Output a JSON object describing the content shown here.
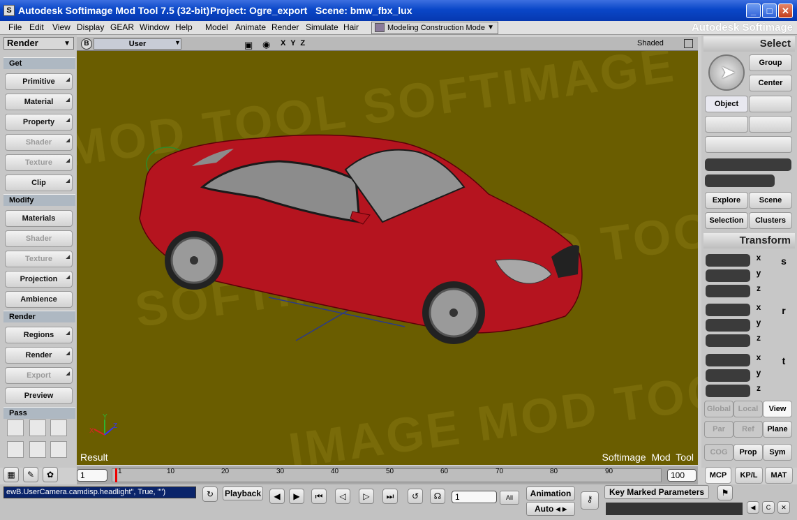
{
  "titlebar": {
    "app": "Autodesk Softimage Mod Tool 7.5 (32-bit)",
    "project": "Project: Ogre_export",
    "scene": "Scene: bmw_fbx_lux",
    "minimize": "_",
    "maximize": "□",
    "close": "✕"
  },
  "menu": {
    "items": [
      "File",
      "Edit",
      "View",
      "Display",
      "GEAR",
      "Window",
      "Help",
      "Model",
      "Animate",
      "Render",
      "Simulate",
      "Hair"
    ],
    "mode": "Modeling Construction Mode",
    "brand": "Autodesk Softimage"
  },
  "left": {
    "tool": "Render",
    "get": "Get",
    "get_items": [
      "Primitive",
      "Material",
      "Property",
      "Shader",
      "Texture",
      "Clip"
    ],
    "modify": "Modify",
    "modify_items": [
      "Materials",
      "Shader",
      "Texture",
      "Projection",
      "Ambience"
    ],
    "render": "Render",
    "render_items": [
      "Regions",
      "Render",
      "Export",
      "Preview"
    ],
    "pass": "Pass"
  },
  "viewport": {
    "cam": "B",
    "camera": "User",
    "axes": "X Y Z",
    "shading": "Shaded",
    "result": "Result",
    "watermark": "Softimage Mod Tool",
    "bg_color": "#6a5d00",
    "car_color": "#b5141f"
  },
  "right": {
    "select": "Select",
    "group": "Group",
    "center": "Center",
    "object": "Object",
    "explore": "Explore",
    "scene": "Scene",
    "selection": "Selection",
    "clusters": "Clusters",
    "transform": "Transform",
    "axes": [
      "x",
      "y",
      "z",
      "x",
      "y",
      "z",
      "x",
      "y",
      "z"
    ],
    "side": [
      "s",
      "r",
      "t"
    ],
    "global": "Global",
    "local": "Local",
    "view": "View",
    "par": "Par",
    "ref": "Ref",
    "plane": "Plane",
    "cog": "COG",
    "prop": "Prop",
    "sym": "Sym",
    "mcp": "MCP",
    "kpl": "KP/L",
    "mat": "MAT"
  },
  "timeline": {
    "start": "1",
    "end": "100",
    "current": "1",
    "ticks": [
      "1",
      "10",
      "20",
      "30",
      "40",
      "50",
      "60",
      "70",
      "80",
      "90"
    ]
  },
  "bottom": {
    "command": "ewB.UserCamera.camdisp.headlight\", True, \"\")",
    "playback": "Playback",
    "frame": "1",
    "all": "All",
    "animation": "Animation",
    "auto": "Auto",
    "keymarked": "Key Marked Parameters"
  }
}
